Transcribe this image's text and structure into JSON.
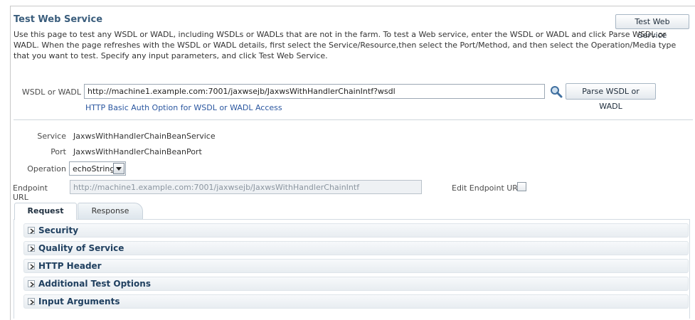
{
  "header": {
    "title": "Test Web Service",
    "test_button_label": "Test Web Service",
    "description": "Use this page to test any WSDL or WADL, including WSDLs or WADLs that are not in the farm. To test a Web service, enter the WSDL or WADL and click Parse WSDL or WADL. When the page refreshes with the WSDL or WADL details, first select the Service/Resource,then select the Port/Method, and then select the Operation/Media type that you want to test. Specify any input parameters, and click Test Web Service."
  },
  "wsdl": {
    "label": "WSDL or WADL",
    "value": "http://machine1.example.com:7001/jaxwsejb/JaxwsWithHandlerChainIntf?wsdl",
    "search_icon": "magnifier-icon",
    "parse_button_label": "Parse WSDL or WADL",
    "auth_link": "HTTP Basic Auth Option for WSDL or WADL Access"
  },
  "details": {
    "service_label": "Service",
    "service_value": "JaxwsWithHandlerChainBeanService",
    "port_label": "Port",
    "port_value": "JaxwsWithHandlerChainBeanPort",
    "operation_label": "Operation",
    "operation_value": "echoString"
  },
  "endpoint": {
    "label": "Endpoint URL",
    "value": "http://machine1.example.com:7001/jaxwsejb/JaxwsWithHandlerChainIntf",
    "edit_label": "Edit Endpoint URL",
    "edit_checked": false
  },
  "tabs": [
    {
      "label": "Request",
      "selected": true
    },
    {
      "label": "Response",
      "selected": false
    }
  ],
  "sections": [
    {
      "label": "Security"
    },
    {
      "label": "Quality of Service"
    },
    {
      "label": "HTTP Header"
    },
    {
      "label": "Additional Test Options"
    },
    {
      "label": "Input Arguments"
    }
  ],
  "colors": {
    "title": "#3a5d7c",
    "link": "#2b57a0",
    "section_label": "#1f3f5f"
  }
}
